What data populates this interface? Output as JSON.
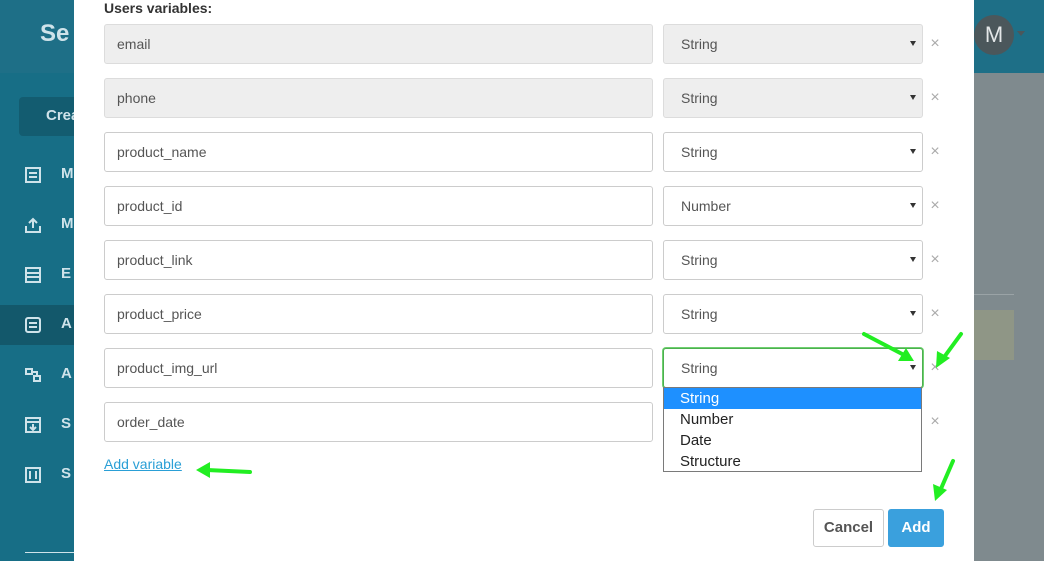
{
  "background": {
    "app_title": "Se",
    "create_button": "Crea",
    "nav": [
      "M",
      "M",
      "E",
      "A",
      "A",
      "S",
      "S"
    ],
    "avatar": "M"
  },
  "modal": {
    "section_label": "Users variables:",
    "variables": [
      {
        "name": "email",
        "type": "String",
        "disabled": true
      },
      {
        "name": "phone",
        "type": "String",
        "disabled": true
      },
      {
        "name": "product_name",
        "type": "String",
        "disabled": false
      },
      {
        "name": "product_id",
        "type": "Number",
        "disabled": false
      },
      {
        "name": "product_link",
        "type": "String",
        "disabled": false
      },
      {
        "name": "product_price",
        "type": "String",
        "disabled": false
      },
      {
        "name": "product_img_url",
        "type": "String",
        "disabled": false,
        "focused": true
      },
      {
        "name": "order_date",
        "type": "",
        "disabled": false
      }
    ],
    "remove_glyph": "×",
    "type_dropdown": {
      "options": [
        "String",
        "Number",
        "Date",
        "Structure"
      ],
      "selected": "String"
    },
    "add_variable_link": "Add variable",
    "cancel_button": "Cancel",
    "add_button": "Add"
  },
  "colors": {
    "accent": "#3aa0dd",
    "annotation_arrow": "#22ee22",
    "focus_border": "#4caf50",
    "dropdown_highlight": "#1e90ff"
  }
}
